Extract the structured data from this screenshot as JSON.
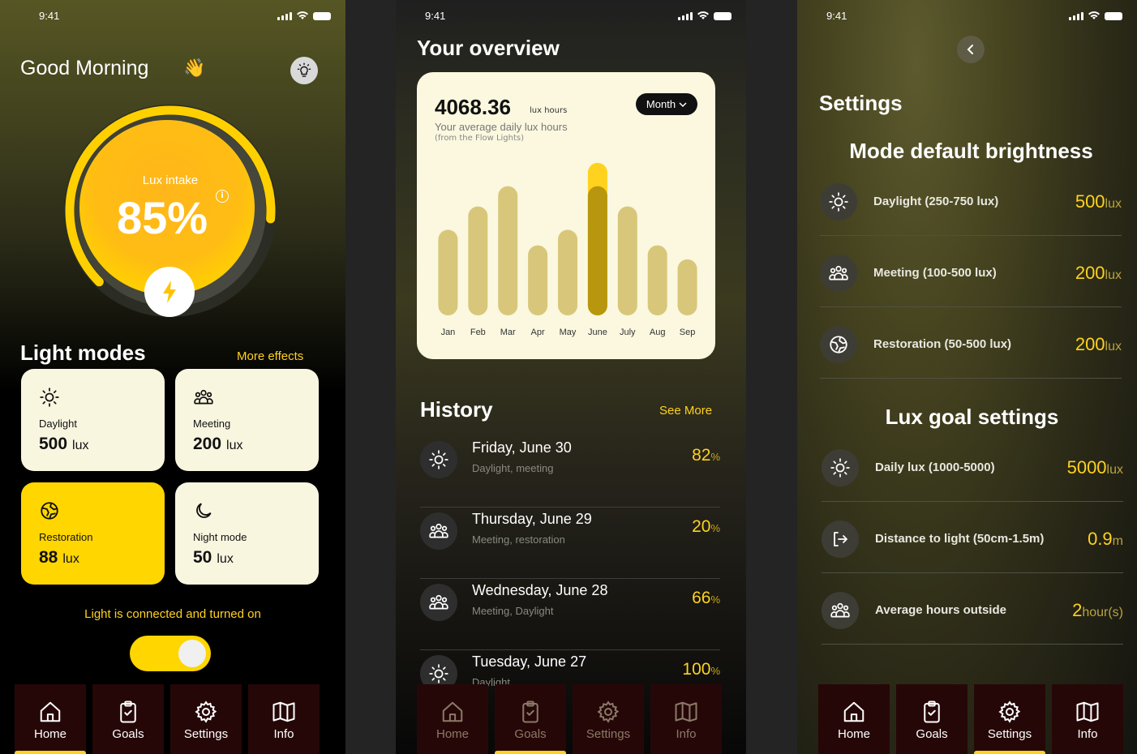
{
  "status": {
    "time": "9:41"
  },
  "home": {
    "greeting": "Good Morning",
    "wave_emoji": "👋",
    "gauge": {
      "label": "Lux intake",
      "value": "85%",
      "fraction": 0.85,
      "info": "i"
    },
    "light_modes_title": "Light modes",
    "more_effects": "More effects",
    "modes": [
      {
        "icon": "sun-icon",
        "name": "Daylight",
        "value": "500",
        "unit": "lux",
        "active": false
      },
      {
        "icon": "people-icon",
        "name": "Meeting",
        "value": "200",
        "unit": "lux",
        "active": false
      },
      {
        "icon": "restoration-icon",
        "name": "Restoration",
        "value": "88",
        "unit": "lux",
        "active": true
      },
      {
        "icon": "moon-icon",
        "name": "Night mode",
        "value": "50",
        "unit": "lux",
        "active": false
      }
    ],
    "connection_status": "Light is connected and turned on",
    "toggle_on": true
  },
  "tabs": [
    "Home",
    "Goals",
    "Settings",
    "Info"
  ],
  "overview": {
    "title": "Your overview",
    "total": "4068.36",
    "total_unit": "lux hours",
    "subtitle": "Your average daily lux hours",
    "subtitle2": "(from the Flow Lights)",
    "period": "Month",
    "chart_data": {
      "type": "bar",
      "categories": [
        "Jan",
        "Feb",
        "Mar",
        "Apr",
        "May",
        "June",
        "July",
        "Aug",
        "Sep"
      ],
      "values": [
        55,
        70,
        83,
        45,
        55,
        83,
        70,
        45,
        36
      ],
      "highlight_index": 5,
      "highlight_extra": 15,
      "ylim": [
        0,
        100
      ],
      "grid": false,
      "title": "",
      "xlabel": "",
      "ylabel": ""
    },
    "history_title": "History",
    "see_more": "See More",
    "history": [
      {
        "icon": "sun-icon",
        "date": "Friday, June 30",
        "sub": "Daylight, meeting",
        "pct": "82",
        "unit": "%"
      },
      {
        "icon": "people-icon",
        "date": "Thursday, June 29",
        "sub": "Meeting, restoration",
        "pct": "20",
        "unit": "%"
      },
      {
        "icon": "people-icon",
        "date": "Wednesday, June 28",
        "sub": "Meeting, Daylight",
        "pct": "66",
        "unit": "%"
      },
      {
        "icon": "sun-icon",
        "date": "Tuesday, June 27",
        "sub": "Daylight",
        "pct": "100",
        "unit": "%"
      }
    ]
  },
  "settings": {
    "title": "Settings",
    "brightness_title": "Mode default brightness",
    "brightness": [
      {
        "icon": "sun-icon",
        "label": "Daylight (250-750 lux)",
        "value": "500",
        "unit": "lux"
      },
      {
        "icon": "people-icon",
        "label": "Meeting (100-500 lux)",
        "value": "200",
        "unit": "lux"
      },
      {
        "icon": "restoration-icon",
        "label": "Restoration (50-500 lux)",
        "value": "200",
        "unit": "lux"
      }
    ],
    "goal_title": "Lux goal settings",
    "goals": [
      {
        "icon": "sun-icon",
        "label": "Daily lux  (1000-5000)",
        "value": "5000",
        "unit": "lux"
      },
      {
        "icon": "distance-icon",
        "label": "Distance to light (50cm-1.5m)",
        "value": "0.9",
        "unit": "m"
      },
      {
        "icon": "people-icon",
        "label": "Average hours outside",
        "value": "2",
        "unit": "hour(s)"
      }
    ]
  },
  "colors": {
    "accent": "#ffd21f",
    "card": "#fbf8df",
    "bar": "#d8c77a",
    "bar_highlight": "#b8960e"
  }
}
